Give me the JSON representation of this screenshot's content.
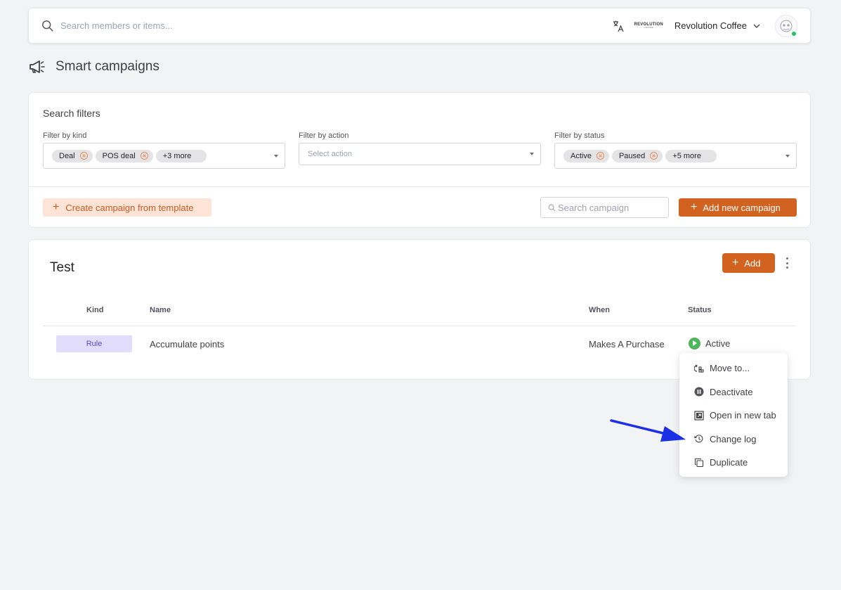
{
  "topbar": {
    "search_placeholder": "Search members or items...",
    "org_name": "Revolution Coffee",
    "logo_text": "REVOLUTION",
    "logo_sub": "COFFEE"
  },
  "page": {
    "title": "Smart campaigns"
  },
  "filters": {
    "title": "Search filters",
    "kind": {
      "label": "Filter by kind",
      "tags": [
        "Deal",
        "POS deal"
      ],
      "more": "+3 more"
    },
    "action": {
      "label": "Filter by action",
      "placeholder": "Select action"
    },
    "status": {
      "label": "Filter by status",
      "tags": [
        "Active",
        "Paused"
      ],
      "more": "+5 more"
    },
    "create_from_template_label": "Create campaign from template",
    "search_campaign_placeholder": "Search campaign",
    "add_new_campaign_label": "Add new campaign"
  },
  "group": {
    "title": "Test",
    "add_label": "Add",
    "columns": {
      "kind": "Kind",
      "name": "Name",
      "when": "When",
      "status": "Status"
    },
    "rows": [
      {
        "kind": "Rule",
        "name": "Accumulate points",
        "when": "Makes A Purchase",
        "status": "Active"
      }
    ]
  },
  "context_menu": {
    "items": [
      {
        "label": "Move to...",
        "icon": "move-icon"
      },
      {
        "label": "Deactivate",
        "icon": "pause-icon"
      },
      {
        "label": "Open in new tab",
        "icon": "external-link-icon"
      },
      {
        "label": "Change log",
        "icon": "history-icon"
      },
      {
        "label": "Duplicate",
        "icon": "copy-icon"
      }
    ]
  },
  "colors": {
    "accent": "#d2621f",
    "accent_light": "#fde4d6",
    "rule_badge_bg": "#e0dcfa",
    "status_active": "#4fb55d",
    "annotation_arrow": "#1a2fe6"
  }
}
